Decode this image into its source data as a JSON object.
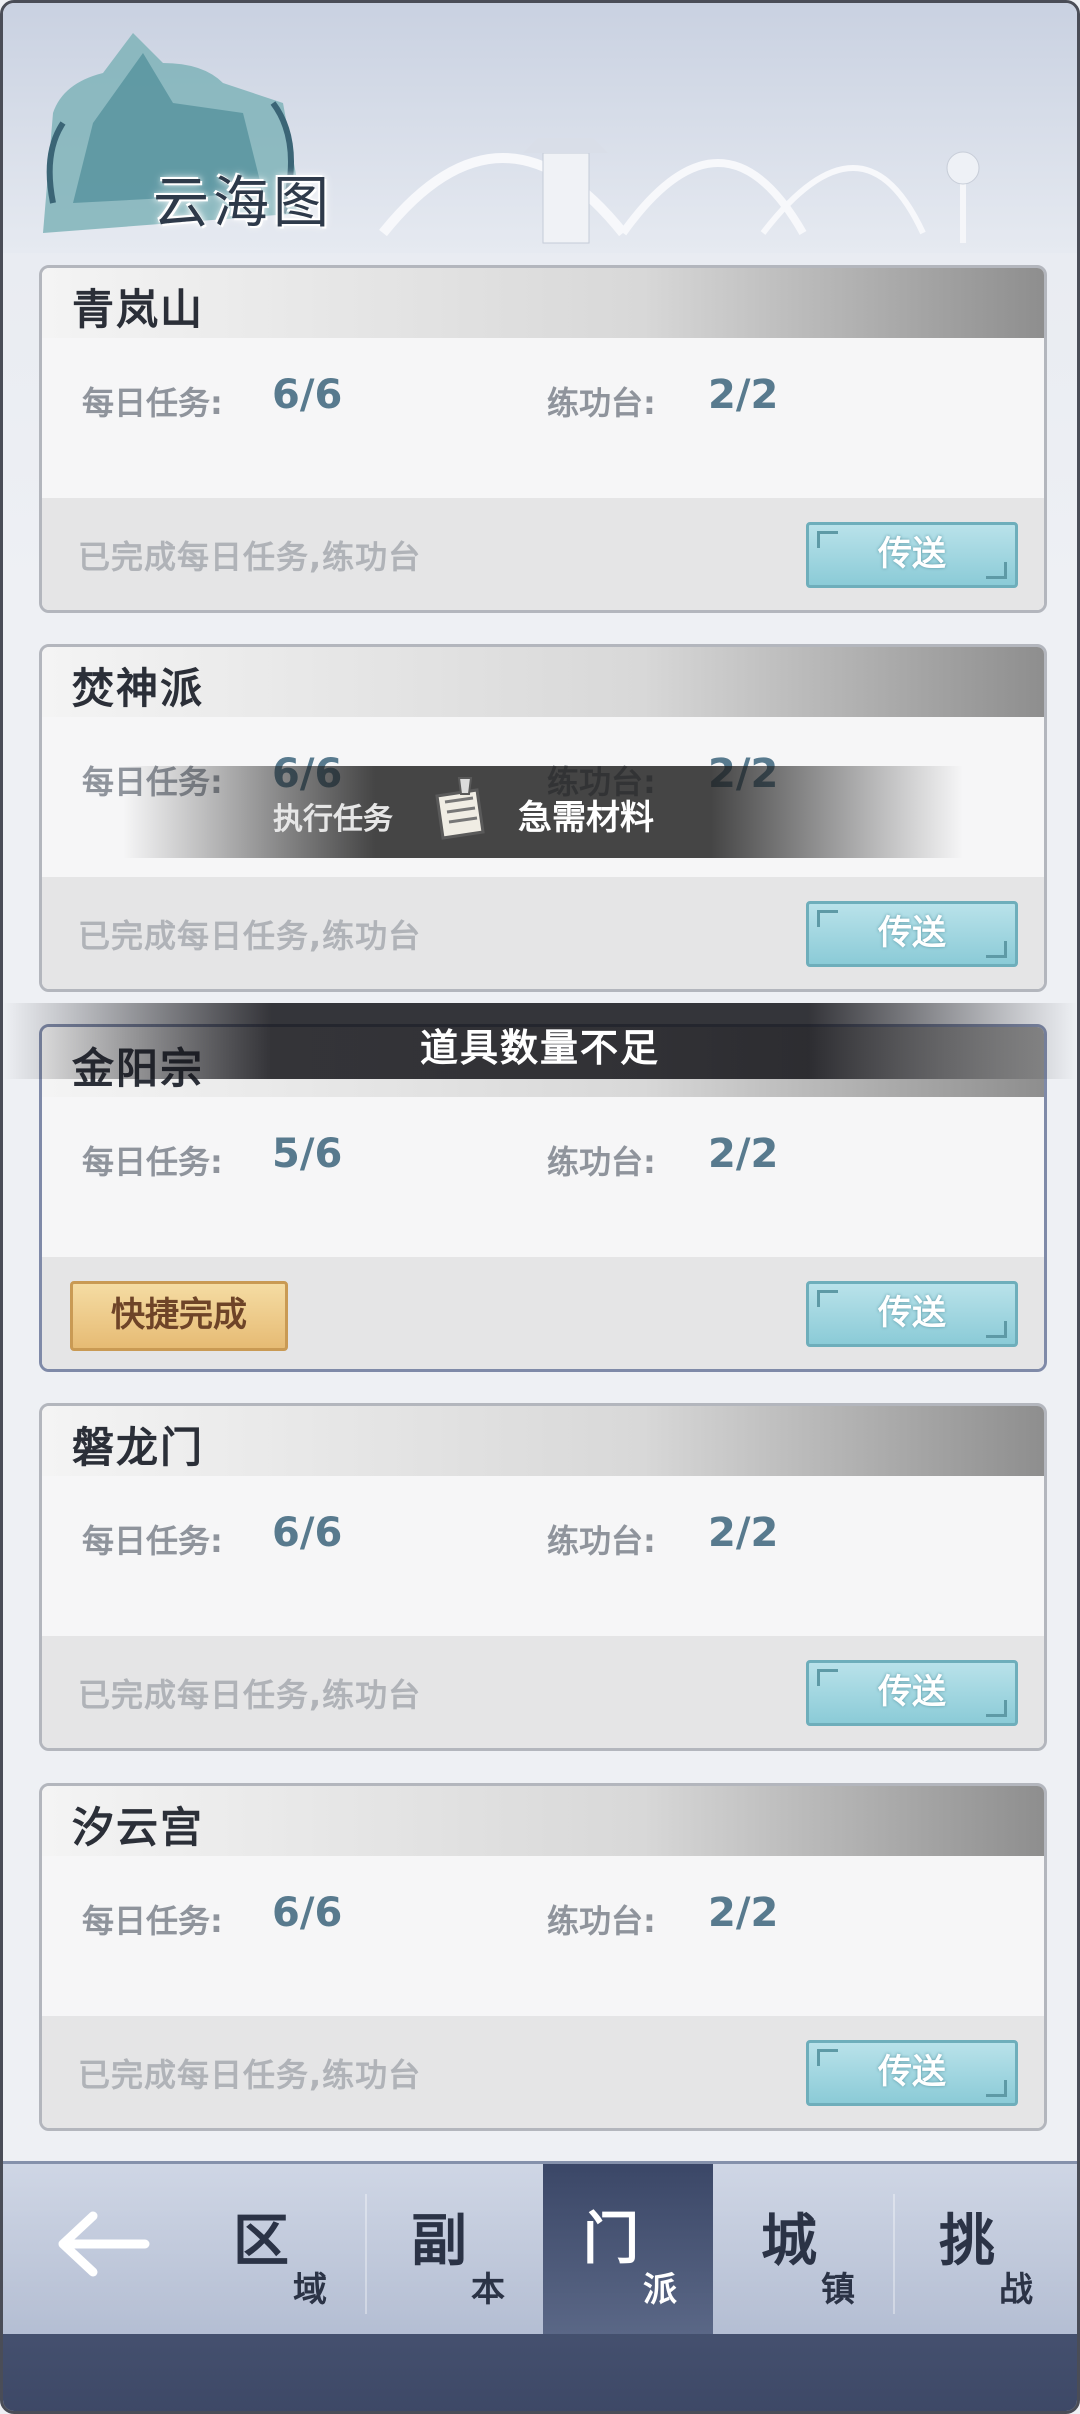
{
  "header": {
    "title": "云海图"
  },
  "stat_labels": {
    "daily": "每日任务:",
    "practice": "练功台:"
  },
  "cards": [
    {
      "name": "青岚山",
      "daily": "6/6",
      "practice": "2/2",
      "status": "已完成每日任务,练功台",
      "teleport": "传送"
    },
    {
      "name": "焚神派",
      "daily": "6/6",
      "practice": "2/2",
      "status": "已完成每日任务,练功台",
      "teleport": "传送"
    },
    {
      "name": "金阳宗",
      "daily": "5/6",
      "practice": "2/2",
      "quick_complete": "快捷完成",
      "teleport": "传送"
    },
    {
      "name": "磐龙门",
      "daily": "6/6",
      "practice": "2/2",
      "status": "已完成每日任务,练功台",
      "teleport": "传送"
    },
    {
      "name": "汐云宫",
      "daily": "6/6",
      "practice": "2/2",
      "status": "已完成每日任务,练功台",
      "teleport": "传送"
    }
  ],
  "toasts": {
    "task_left": "执行任务",
    "task_right": "急需材料",
    "warning": "道具数量不足"
  },
  "nav": {
    "back_icon": "arrow-left-icon",
    "items": [
      {
        "big": "区",
        "small": "域"
      },
      {
        "big": "副",
        "small": "本"
      },
      {
        "big": "门",
        "small": "派",
        "active": true
      },
      {
        "big": "城",
        "small": "镇"
      },
      {
        "big": "挑",
        "small": "战"
      }
    ]
  },
  "colors": {
    "accent_value": "#587a8e",
    "teleport_button": "#8bcbd7",
    "quick_button": "#e6bb74",
    "nav_bg": "#4a5675"
  }
}
